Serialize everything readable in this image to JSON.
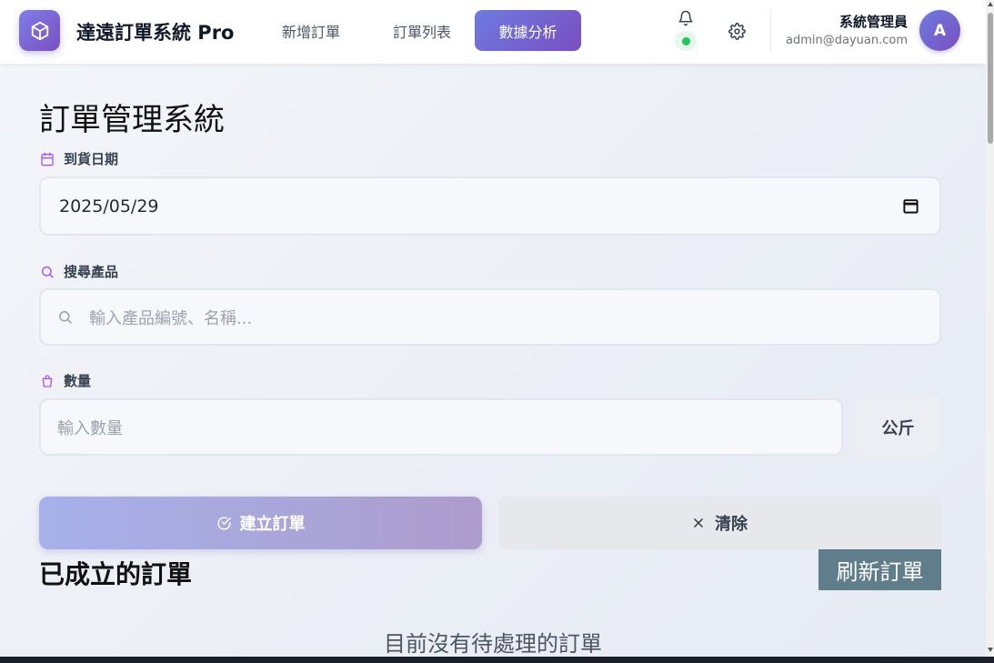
{
  "app": {
    "brand": "達遠訂單系統 Pro",
    "logo_icon": "cube-icon"
  },
  "nav": {
    "items": [
      {
        "label": "新增訂單",
        "active": false
      },
      {
        "label": "訂單列表",
        "active": false
      },
      {
        "label": "數據分析",
        "active": true
      }
    ]
  },
  "header": {
    "notification_icon": "bell-icon",
    "status_color": "#22c55e",
    "settings_icon": "gear-icon",
    "user_name": "系統管理員",
    "user_email": "admin@dayuan.com",
    "avatar_letter": "A"
  },
  "main": {
    "title": "訂單管理系統",
    "date_field": {
      "label": "到貨日期",
      "value": "2025/05/29"
    },
    "search_field": {
      "label": "搜尋產品",
      "placeholder": "輸入產品編號、名稱..."
    },
    "quantity_field": {
      "label": "數量",
      "placeholder": "輸入數量",
      "unit": "公斤"
    },
    "create_button": "建立訂單",
    "clear_button": "清除",
    "orders_section": {
      "title": "已成立的訂單",
      "refresh_button": "刷新訂單",
      "empty_message": "目前沒有待處理的訂單"
    }
  },
  "colors": {
    "accent_start": "#6d7be0",
    "accent_end": "#7a4fc0",
    "label_icon": "#a855f7",
    "refresh_button": "#607d8b"
  }
}
